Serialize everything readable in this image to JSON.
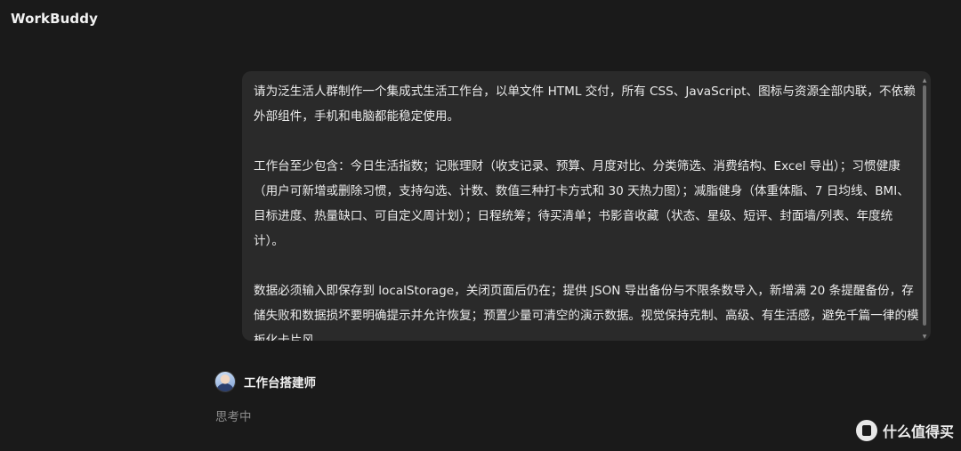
{
  "app": {
    "title": "WorkBuddy"
  },
  "message": {
    "paragraphs": [
      "请为泛生活人群制作一个集成式生活工作台，以单文件 HTML 交付，所有 CSS、JavaScript、图标与资源全部内联，不依赖外部组件，手机和电脑都能稳定使用。",
      "工作台至少包含：今日生活指数；记账理财（收支记录、预算、月度对比、分类筛选、消费结构、Excel 导出）；习惯健康（用户可新增或删除习惯，支持勾选、计数、数值三种打卡方式和 30 天热力图）；减脂健身（体重体脂、7 日均线、BMI、目标进度、热量缺口、可自定义周计划）；日程统筹；待买清单；书影音收藏（状态、星级、短评、封面墙/列表、年度统计）。",
      "数据必须输入即保存到 localStorage，关闭页面后仍在；提供 JSON 导出备份与不限条数导入，新增满 20 条提醒备份，存储失败和数据损坏要明确提示并允许恢复；预置少量可清空的演示数据。视觉保持克制、高级、有生活感，避免千篇一律的模板化卡片风。"
    ]
  },
  "agent": {
    "name": "工作台搭建师",
    "avatar_icon": "avatar-icon",
    "status": "思考中"
  },
  "watermark": {
    "text": "什么值得买",
    "logo_icon": "smzdm-logo-icon"
  },
  "colors": {
    "background": "#1a1a1a",
    "bubble": "#2a2a2a",
    "text": "#ececec",
    "muted": "#8c8c8c"
  }
}
